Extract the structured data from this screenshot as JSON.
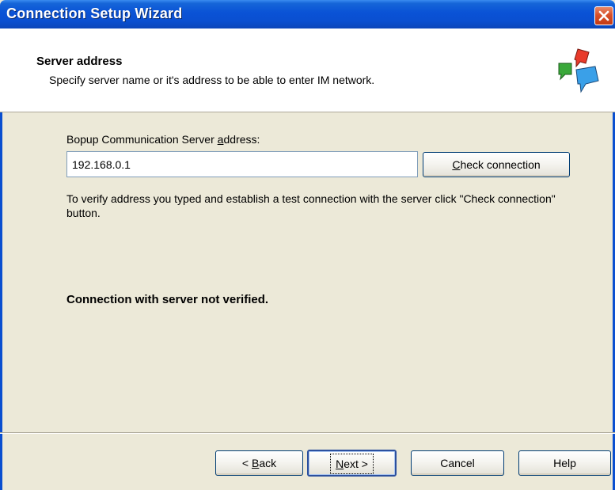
{
  "window": {
    "title": "Connection Setup Wizard"
  },
  "header": {
    "title": "Server address",
    "subtitle": "Specify server name or it's address to be able to enter IM network.",
    "icon": "chat-bubbles-icon"
  },
  "form": {
    "server_label_pre": "Bopup Communication Server ",
    "server_label_accel": "a",
    "server_label_post": "ddress:",
    "server_value": "192.168.0.1",
    "check_pre": "",
    "check_accel": "C",
    "check_post": "heck connection",
    "verify_text": "To verify address you typed and establish a test connection with the server click \"Check connection\" button.",
    "status_text": "Connection with server not verified."
  },
  "footer": {
    "back_pre": "< ",
    "back_accel": "B",
    "back_post": "ack",
    "next_accel": "N",
    "next_post": "ext >",
    "cancel_label": "Cancel",
    "help_label": "Help"
  },
  "colors": {
    "titlebar": "#0a4fd0",
    "dialog_bg": "#ece9d8",
    "close_button": "#d8502a"
  }
}
